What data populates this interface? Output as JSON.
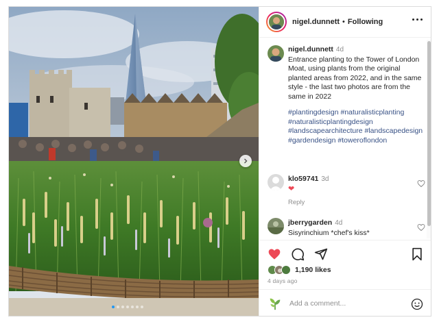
{
  "post": {
    "author": "nigel.dunnett",
    "separator": "•",
    "follow_status": "Following",
    "caption": {
      "username": "nigel.dunnett",
      "time": "4d",
      "text": "Entrance planting to the Tower of London Moat, using plants from the original planted areas from 2022, and in the same style - the last two photos are from the same in 2022",
      "hashtags": "#plantingdesign #naturalisticplanting #naturalisticplantingdesign #landscapearchitecture #landscapedesign #gardendesign #toweroflondon"
    },
    "comments": [
      {
        "username": "klo59741",
        "time": "3d",
        "text": "❤",
        "reply_label": "Reply"
      },
      {
        "username": "jberrygarden",
        "time": "4d",
        "text": "Sisyrinchium *chef's kiss*"
      }
    ],
    "likes": "1,190 likes",
    "posted": "4 days ago",
    "add_comment_placeholder": "Add a comment...",
    "carousel": {
      "count": 7,
      "active": 0
    }
  },
  "icons": {
    "more": "more-options-icon",
    "like": "heart-filled-icon",
    "comment": "comment-icon",
    "share": "share-icon",
    "save": "bookmark-icon",
    "next": "chevron-right-icon",
    "emoji": "emoji-icon"
  },
  "colors": {
    "like": "#ed4956",
    "hashtag": "#385185",
    "muted": "#8e8e8e",
    "active_dot": "#2196f3"
  }
}
